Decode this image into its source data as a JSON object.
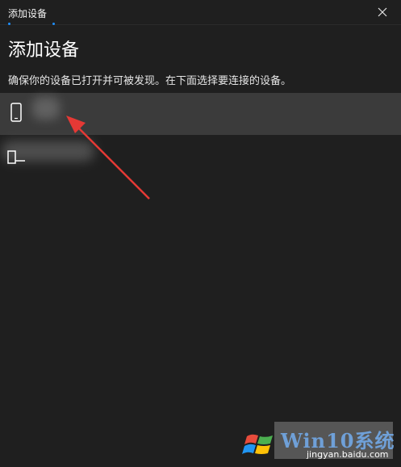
{
  "window": {
    "title": "添加设备",
    "close_glyph": "✕"
  },
  "heading": "添加设备",
  "description": "确保你的设备已打开并可被发现。在下面选择要连接的设备。",
  "devices": [
    {
      "icon": "phone-icon",
      "selected": true
    },
    {
      "icon": "device-icon",
      "selected": false
    }
  ],
  "annotation": {
    "color": "#e53935"
  },
  "watermark": {
    "brand": "Win10系统",
    "url": "jingyan.baidu.com"
  },
  "colors": {
    "background": "#1f1f1f",
    "selected_row": "#3b3b3b",
    "accent_dots": "#1e90ff"
  }
}
